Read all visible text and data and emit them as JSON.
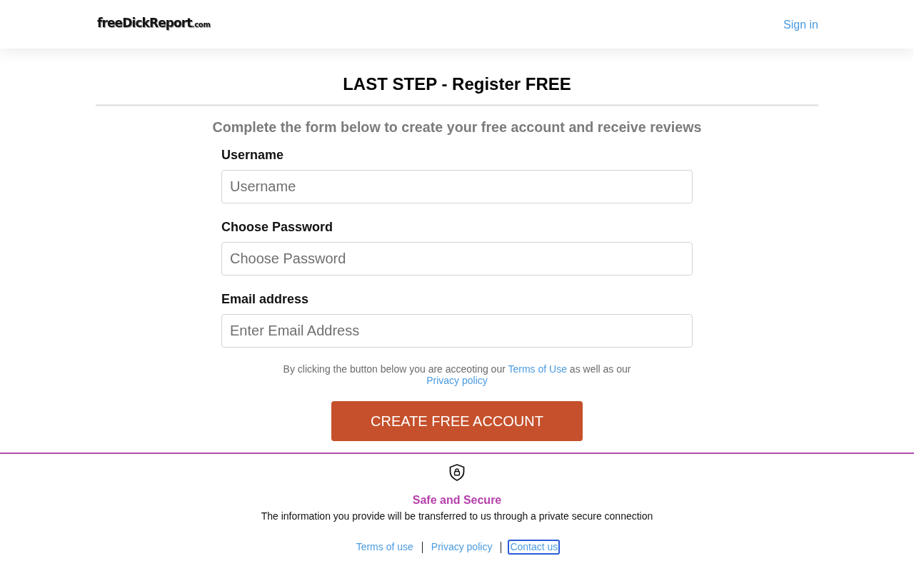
{
  "header": {
    "logo": {
      "name": "freeDickReport",
      "suffix": ".com"
    },
    "sign_in": "Sign in"
  },
  "form": {
    "title": "LAST STEP - Register FREE",
    "subtitle": "Complete the form below to create your free account and receive reviews",
    "fields": [
      {
        "label": "Username",
        "placeholder": "Username"
      },
      {
        "label": "Choose Password",
        "placeholder": "Choose Password"
      },
      {
        "label": "Email address",
        "placeholder": "Enter Email Address"
      }
    ],
    "consent": [
      {
        "kind": "text",
        "text": "By clicking the button below you are acceoting our"
      },
      {
        "kind": "link",
        "text": "Terms of Use"
      },
      {
        "kind": "text",
        "text": "as well as our"
      },
      {
        "kind": "link",
        "text": "Privacy policy"
      }
    ],
    "submit": "CREATE FREE ACCOUNT"
  },
  "security": {
    "title": "Safe and Secure",
    "text": "The information you provide will be transferred to us through a private secure connection"
  },
  "footer_links": [
    {
      "label": "Terms of use",
      "focused": false
    },
    {
      "label": "Privacy policy",
      "focused": false
    },
    {
      "label": "Contact us",
      "focused": true
    }
  ]
}
